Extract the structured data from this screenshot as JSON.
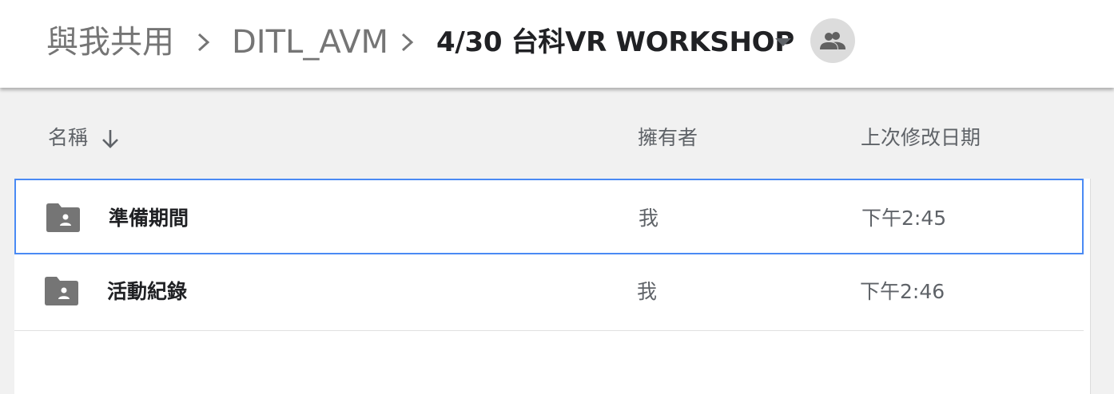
{
  "breadcrumb": {
    "root": "與我共用",
    "parent": "DITL_AVM",
    "current": "4/30 台科VR WORKSHOP"
  },
  "columns": {
    "name": "名稱",
    "owner": "擁有者",
    "modified": "上次修改日期"
  },
  "sort": {
    "column": "name",
    "direction": "descending"
  },
  "rows": [
    {
      "name": "準備期間",
      "owner": "我",
      "modified": "下午2:45",
      "type": "shared-folder",
      "selected": true
    },
    {
      "name": "活動紀錄",
      "owner": "我",
      "modified": "下午2:46",
      "type": "shared-folder",
      "selected": false
    }
  ],
  "icons": {
    "breadcrumb_separator": "chevron-right-icon",
    "breadcrumb_menu": "caret-down-icon",
    "share_status": "people-icon",
    "sort": "arrow-down-icon",
    "row_type": "shared-folder-icon"
  },
  "colors": {
    "selection_border": "#4a8af4",
    "folder_icon": "#757575",
    "header_bg": "#ffffff",
    "list_header_bg": "#f1f1f1"
  }
}
